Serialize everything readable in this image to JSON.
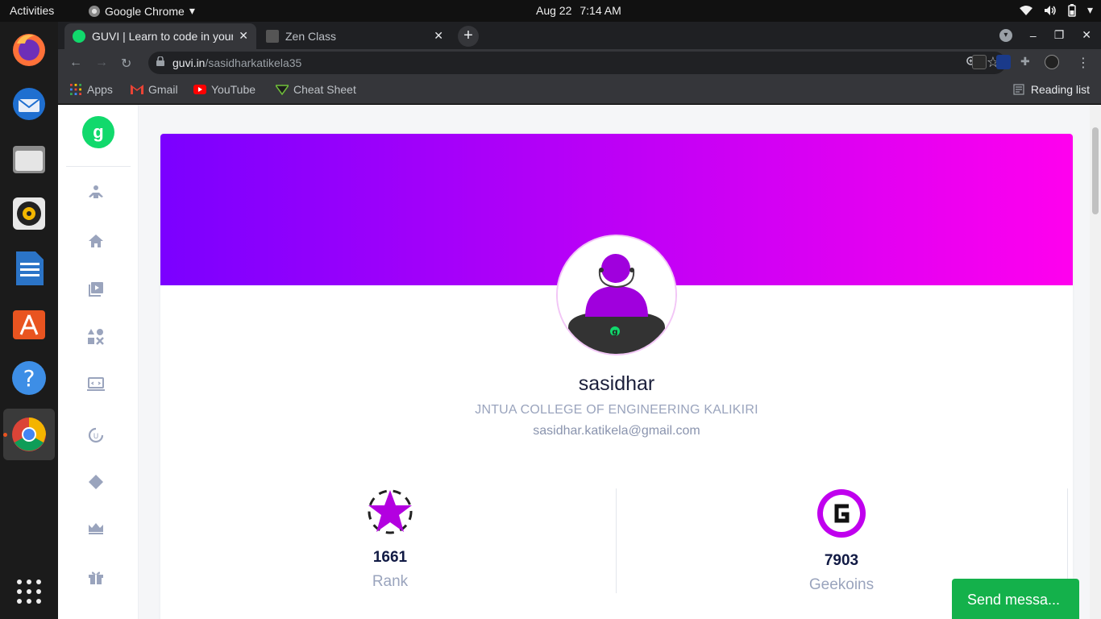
{
  "system": {
    "activities": "Activities",
    "app_menu": "Google Chrome",
    "date": "Aug 22",
    "time": "7:14 AM"
  },
  "browser": {
    "tabs": [
      {
        "title": "GUVI | Learn to code in your",
        "favicon": "guvi-icon",
        "active": true
      },
      {
        "title": "Zen Class",
        "favicon": "zen-class-icon",
        "active": false
      }
    ],
    "url_host": "guvi.in",
    "url_path": "/sasidharkatikela35",
    "bookmarks": [
      {
        "label": "Apps",
        "icon": "apps-grid-icon"
      },
      {
        "label": "Gmail",
        "icon": "gmail-icon"
      },
      {
        "label": "YouTube",
        "icon": "youtube-icon"
      },
      {
        "label": "Cheat Sheet",
        "icon": "cheat-sheet-icon"
      }
    ],
    "reading_list": "Reading list"
  },
  "profile": {
    "name": "sasidhar",
    "college": "JNTUA COLLEGE OF ENGINEERING KALIKIRI",
    "email": "sasidhar.katikela@gmail.com",
    "stats": [
      {
        "value": "1661",
        "label": "Rank",
        "icon": "rank-star-icon"
      },
      {
        "value": "7903",
        "label": "Geekoins",
        "icon": "geekoins-icon"
      }
    ]
  },
  "chat": {
    "send_label": "Send messa..."
  },
  "colors": {
    "banner_start": "#7b00ff",
    "banner_end": "#ff00ee",
    "brand_green": "#11d96c",
    "chat_green": "#14b14b"
  }
}
